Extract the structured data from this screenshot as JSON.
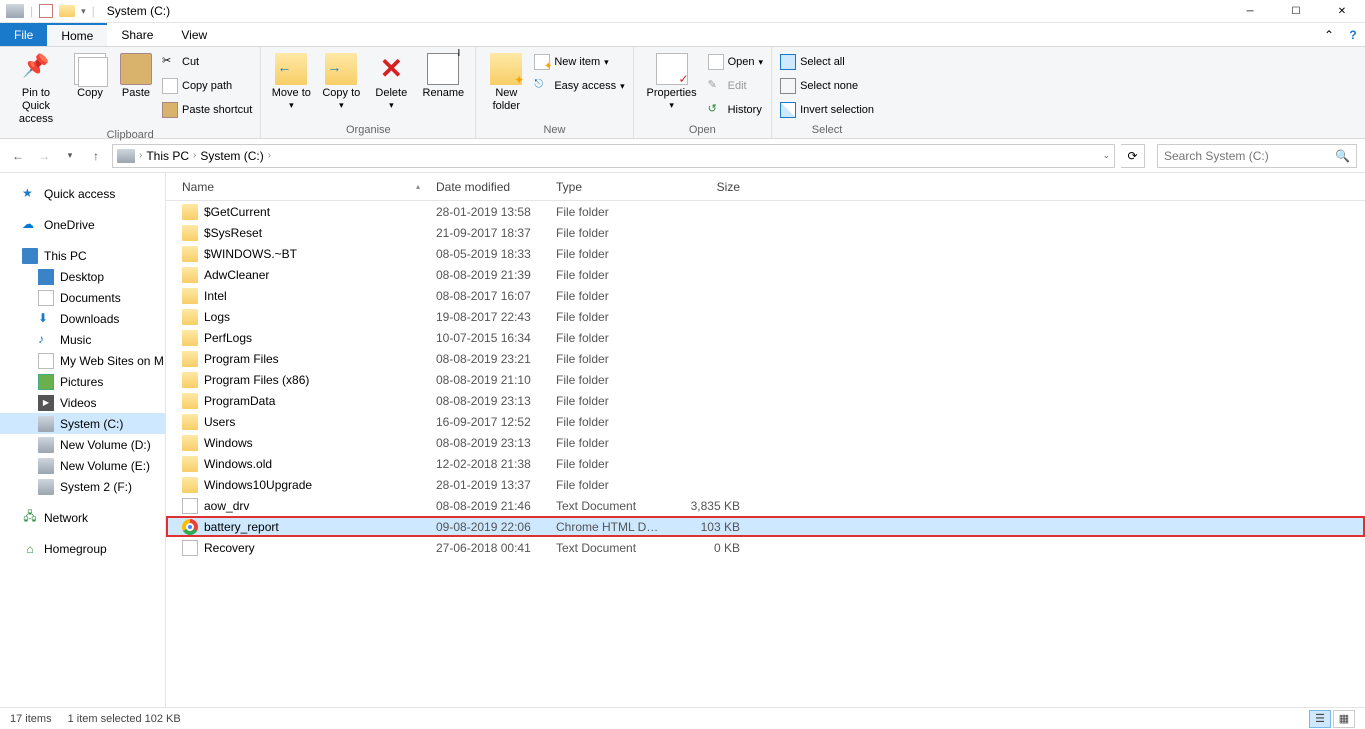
{
  "window": {
    "title": "System (C:)"
  },
  "tabs": {
    "file": "File",
    "home": "Home",
    "share": "Share",
    "view": "View"
  },
  "ribbon": {
    "clipboard": {
      "label": "Clipboard",
      "pin": "Pin to Quick access",
      "copy": "Copy",
      "paste": "Paste",
      "cut": "Cut",
      "copy_path": "Copy path",
      "paste_shortcut": "Paste shortcut"
    },
    "organise": {
      "label": "Organise",
      "move_to": "Move to",
      "copy_to": "Copy to",
      "delete": "Delete",
      "rename": "Rename"
    },
    "new": {
      "label": "New",
      "new_folder": "New folder",
      "new_item": "New item",
      "easy_access": "Easy access"
    },
    "open": {
      "label": "Open",
      "properties": "Properties",
      "open": "Open",
      "edit": "Edit",
      "history": "History"
    },
    "select": {
      "label": "Select",
      "select_all": "Select all",
      "select_none": "Select none",
      "invert": "Invert selection"
    }
  },
  "breadcrumb": {
    "root": "This PC",
    "current": "System (C:)"
  },
  "search": {
    "placeholder": "Search System (C:)"
  },
  "nav": {
    "quick_access": "Quick access",
    "onedrive": "OneDrive",
    "this_pc": "This PC",
    "desktop": "Desktop",
    "documents": "Documents",
    "downloads": "Downloads",
    "music": "Music",
    "my_web_sites": "My Web Sites on M",
    "pictures": "Pictures",
    "videos": "Videos",
    "system_c": "System (C:)",
    "new_vol_d": "New Volume (D:)",
    "new_vol_e": "New Volume (E:)",
    "system_2_f": "System 2 (F:)",
    "network": "Network",
    "homegroup": "Homegroup"
  },
  "columns": {
    "name": "Name",
    "date": "Date modified",
    "type": "Type",
    "size": "Size"
  },
  "files": [
    {
      "name": "$GetCurrent",
      "date": "28-01-2019 13:58",
      "type": "File folder",
      "size": "",
      "icon": "folder"
    },
    {
      "name": "$SysReset",
      "date": "21-09-2017 18:37",
      "type": "File folder",
      "size": "",
      "icon": "folder"
    },
    {
      "name": "$WINDOWS.~BT",
      "date": "08-05-2019 18:33",
      "type": "File folder",
      "size": "",
      "icon": "folder"
    },
    {
      "name": "AdwCleaner",
      "date": "08-08-2019 21:39",
      "type": "File folder",
      "size": "",
      "icon": "folder"
    },
    {
      "name": "Intel",
      "date": "08-08-2017 16:07",
      "type": "File folder",
      "size": "",
      "icon": "folder"
    },
    {
      "name": "Logs",
      "date": "19-08-2017 22:43",
      "type": "File folder",
      "size": "",
      "icon": "folder"
    },
    {
      "name": "PerfLogs",
      "date": "10-07-2015 16:34",
      "type": "File folder",
      "size": "",
      "icon": "folder"
    },
    {
      "name": "Program Files",
      "date": "08-08-2019 23:21",
      "type": "File folder",
      "size": "",
      "icon": "folder"
    },
    {
      "name": "Program Files (x86)",
      "date": "08-08-2019 21:10",
      "type": "File folder",
      "size": "",
      "icon": "folder"
    },
    {
      "name": "ProgramData",
      "date": "08-08-2019 23:13",
      "type": "File folder",
      "size": "",
      "icon": "folder"
    },
    {
      "name": "Users",
      "date": "16-09-2017 12:52",
      "type": "File folder",
      "size": "",
      "icon": "folder"
    },
    {
      "name": "Windows",
      "date": "08-08-2019 23:13",
      "type": "File folder",
      "size": "",
      "icon": "folder"
    },
    {
      "name": "Windows.old",
      "date": "12-02-2018 21:38",
      "type": "File folder",
      "size": "",
      "icon": "folder"
    },
    {
      "name": "Windows10Upgrade",
      "date": "28-01-2019 13:37",
      "type": "File folder",
      "size": "",
      "icon": "folder"
    },
    {
      "name": "aow_drv",
      "date": "08-08-2019 21:46",
      "type": "Text Document",
      "size": "3,835 KB",
      "icon": "file"
    },
    {
      "name": "battery_report",
      "date": "09-08-2019 22:06",
      "type": "Chrome HTML Do...",
      "size": "103 KB",
      "icon": "chrome",
      "selected": true,
      "highlighted": true
    },
    {
      "name": "Recovery",
      "date": "27-06-2018 00:41",
      "type": "Text Document",
      "size": "0 KB",
      "icon": "file"
    }
  ],
  "status": {
    "items": "17 items",
    "selection": "1 item selected  102 KB"
  }
}
